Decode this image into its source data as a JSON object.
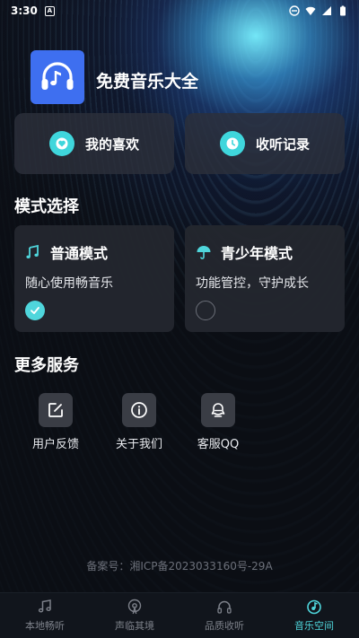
{
  "status_bar": {
    "time": "3:30",
    "notif_letter": "A"
  },
  "app": {
    "title": "免费音乐大全"
  },
  "quick_actions": [
    {
      "label": "我的喜欢",
      "icon": "heart-icon"
    },
    {
      "label": "收听记录",
      "icon": "clock-icon"
    }
  ],
  "mode_section": {
    "title": "模式选择",
    "modes": [
      {
        "name": "普通模式",
        "desc": "随心使用畅音乐",
        "icon": "music-notes-icon",
        "selected": true
      },
      {
        "name": "青少年模式",
        "desc": "功能管控，守护成长",
        "icon": "umbrella-icon",
        "selected": false
      }
    ]
  },
  "services_section": {
    "title": "更多服务",
    "items": [
      {
        "label": "用户反馈",
        "icon": "edit-icon"
      },
      {
        "label": "关于我们",
        "icon": "info-icon"
      },
      {
        "label": "客服QQ",
        "icon": "qq-icon"
      }
    ]
  },
  "icp": "备案号：湘ICP备2023033160号-29A",
  "bottom_nav": [
    {
      "label": "本地畅听",
      "icon": "music-note-icon",
      "active": false
    },
    {
      "label": "声临其境",
      "icon": "podcast-icon",
      "active": false
    },
    {
      "label": "品质收听",
      "icon": "headphones-icon",
      "active": false
    },
    {
      "label": "音乐空间",
      "icon": "music-disc-icon",
      "active": true
    }
  ],
  "colors": {
    "accent": "#4fd6dc",
    "logo_bg": "#3e6ff0",
    "card_bg": "#24272e"
  }
}
